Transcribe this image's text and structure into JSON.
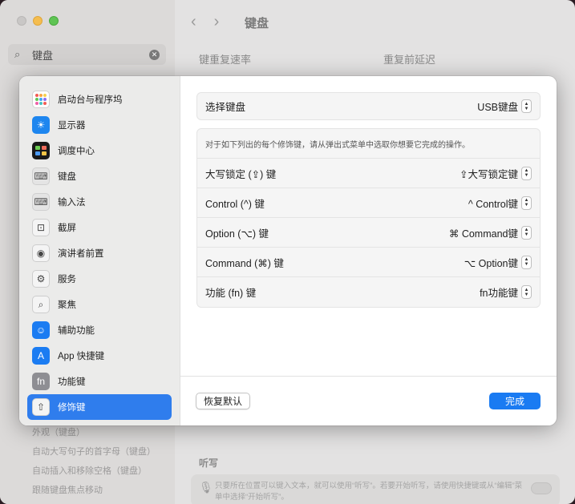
{
  "background": {
    "search": {
      "value": "键盘"
    },
    "title": "键盘",
    "label_repeat_rate": "键重复速率",
    "label_repeat_delay": "重复前延迟",
    "list_items": [
      "外观（键盘）",
      "自动大写句子的首字母（键盘）",
      "自动插入和移除空格（键盘）",
      "跟随键盘焦点移动"
    ],
    "dictation_title": "听写",
    "dictation_desc": "只要所在位置可以键入文本，就可以使用“听写”。若要开始听写，请使用快捷键或从“编辑”菜单中选择“开始听写”。"
  },
  "sidebar": {
    "items": [
      {
        "label": "启动台与程序坞",
        "icon": "launchpad-icon"
      },
      {
        "label": "显示器",
        "icon": "display-icon"
      },
      {
        "label": "调度中心",
        "icon": "mission-control-icon"
      },
      {
        "label": "键盘",
        "icon": "keyboard-icon"
      },
      {
        "label": "输入法",
        "icon": "input-method-icon"
      },
      {
        "label": "截屏",
        "icon": "screenshot-icon"
      },
      {
        "label": "演讲者前置",
        "icon": "presenter-icon"
      },
      {
        "label": "服务",
        "icon": "services-icon"
      },
      {
        "label": "聚焦",
        "icon": "spotlight-icon"
      },
      {
        "label": "辅助功能",
        "icon": "accessibility-icon"
      },
      {
        "label": "App 快捷键",
        "icon": "app-shortcuts-icon"
      },
      {
        "label": "功能键",
        "icon": "function-keys-icon"
      },
      {
        "label": "修饰键",
        "icon": "modifier-keys-icon",
        "selected": true
      }
    ]
  },
  "main": {
    "select_keyboard_label": "选择键盘",
    "select_keyboard_value": "USB键盘",
    "description": "对于如下列出的每个修饰键，请从弹出式菜单中选取你想要它完成的操作。",
    "modifiers": [
      {
        "label": "大写锁定 (⇪) 键",
        "value": "⇪大写锁定键"
      },
      {
        "label": "Control (^) 键",
        "value": "^ Control键"
      },
      {
        "label": "Option (⌥) 键",
        "value": "⌘ Command键"
      },
      {
        "label": "Command (⌘) 键",
        "value": "⌥ Option键"
      },
      {
        "label": "功能 (fn) 键",
        "value": "fn功能键"
      }
    ]
  },
  "footer": {
    "restore_label": "恢复默认",
    "done_label": "完成"
  },
  "colors": {
    "accent": "#1a7bf2",
    "selected": "#2f7ded"
  }
}
